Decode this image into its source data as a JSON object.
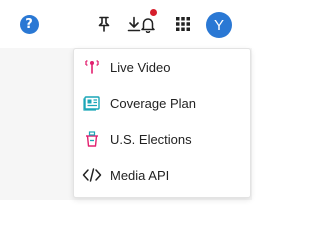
{
  "topbar": {
    "help_glyph": "?",
    "icons": [
      "help-icon",
      "pin-icon",
      "download-icon",
      "bell-icon",
      "apps-grid-icon"
    ],
    "notification_dot_color": "#d61f2c",
    "avatar_initial": "Y",
    "accent_color": "#2a78d4"
  },
  "dropdown": {
    "items": [
      {
        "label": "Live Video",
        "icon": "live-video-icon",
        "icon_color": "#e2206f"
      },
      {
        "label": "Coverage Plan",
        "icon": "coverage-plan-icon",
        "icon_color": "#1aa6b7"
      },
      {
        "label": "U.S. Elections",
        "icon": "us-elections-icon",
        "icon_color": "#e2206f"
      },
      {
        "label": "Media API",
        "icon": "code-icon",
        "icon_color": "#222222"
      }
    ]
  }
}
